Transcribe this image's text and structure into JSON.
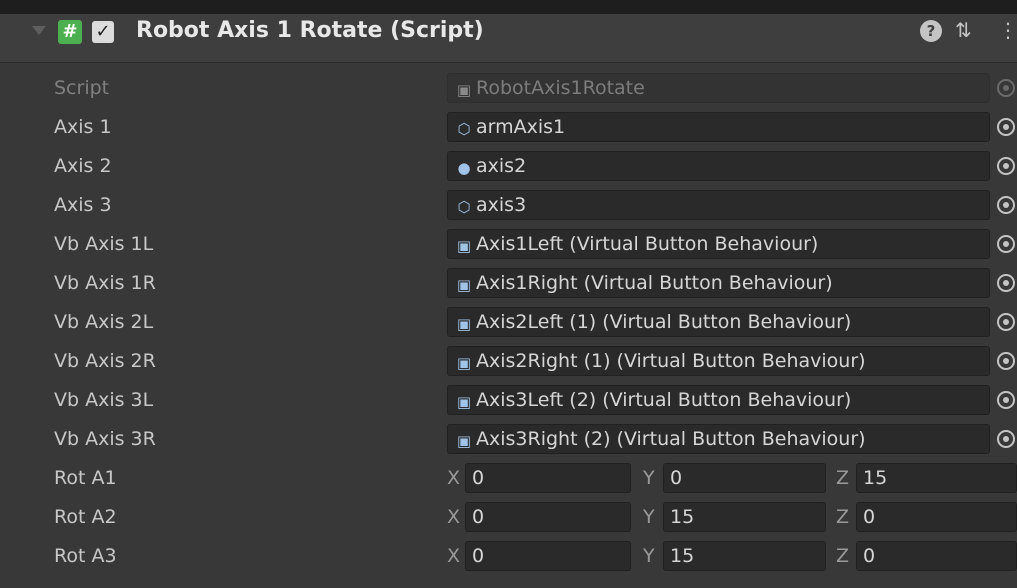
{
  "component": {
    "title": "Robot Axis 1 Rotate (Script)",
    "enabled": true,
    "icons": [
      "foldout-arrow-icon",
      "script-hash-icon",
      "enabled-checkbox-icon",
      "help-icon",
      "preset-icon",
      "more-menu-icon"
    ]
  },
  "fields": [
    {
      "label": "Script",
      "value": "RobotAxis1Rotate",
      "icon": "script-file-icon",
      "disabled": true
    },
    {
      "label": "Axis 1",
      "value": "armAxis1",
      "icon": "gameobject-icon"
    },
    {
      "label": "Axis 2",
      "value": "axis2",
      "icon": "sphere-icon"
    },
    {
      "label": "Axis 3",
      "value": "axis3",
      "icon": "gameobject-icon"
    },
    {
      "label": "Vb Axis 1L",
      "value": "Axis1Left (Virtual Button Behaviour)",
      "icon": "script-component-icon"
    },
    {
      "label": "Vb Axis 1R",
      "value": "Axis1Right (Virtual Button Behaviour)",
      "icon": "script-component-icon"
    },
    {
      "label": "Vb Axis 2L",
      "value": "Axis2Left (1) (Virtual Button Behaviour)",
      "icon": "script-component-icon"
    },
    {
      "label": "Vb Axis 2R",
      "value": "Axis2Right (1) (Virtual Button Behaviour)",
      "icon": "script-component-icon"
    },
    {
      "label": "Vb Axis 3L",
      "value": "Axis3Left (2) (Virtual Button Behaviour)",
      "icon": "script-component-icon"
    },
    {
      "label": "Vb Axis 3R",
      "value": "Axis3Right (2) (Virtual Button Behaviour)",
      "icon": "script-component-icon"
    }
  ],
  "vectors": [
    {
      "label": "Rot A1",
      "x": "0",
      "y": "0",
      "z": "15"
    },
    {
      "label": "Rot A2",
      "x": "0",
      "y": "15",
      "z": "0"
    },
    {
      "label": "Rot A3",
      "x": "0",
      "y": "15",
      "z": "0"
    }
  ],
  "axis_labels": {
    "x": "X",
    "y": "Y",
    "z": "Z"
  }
}
